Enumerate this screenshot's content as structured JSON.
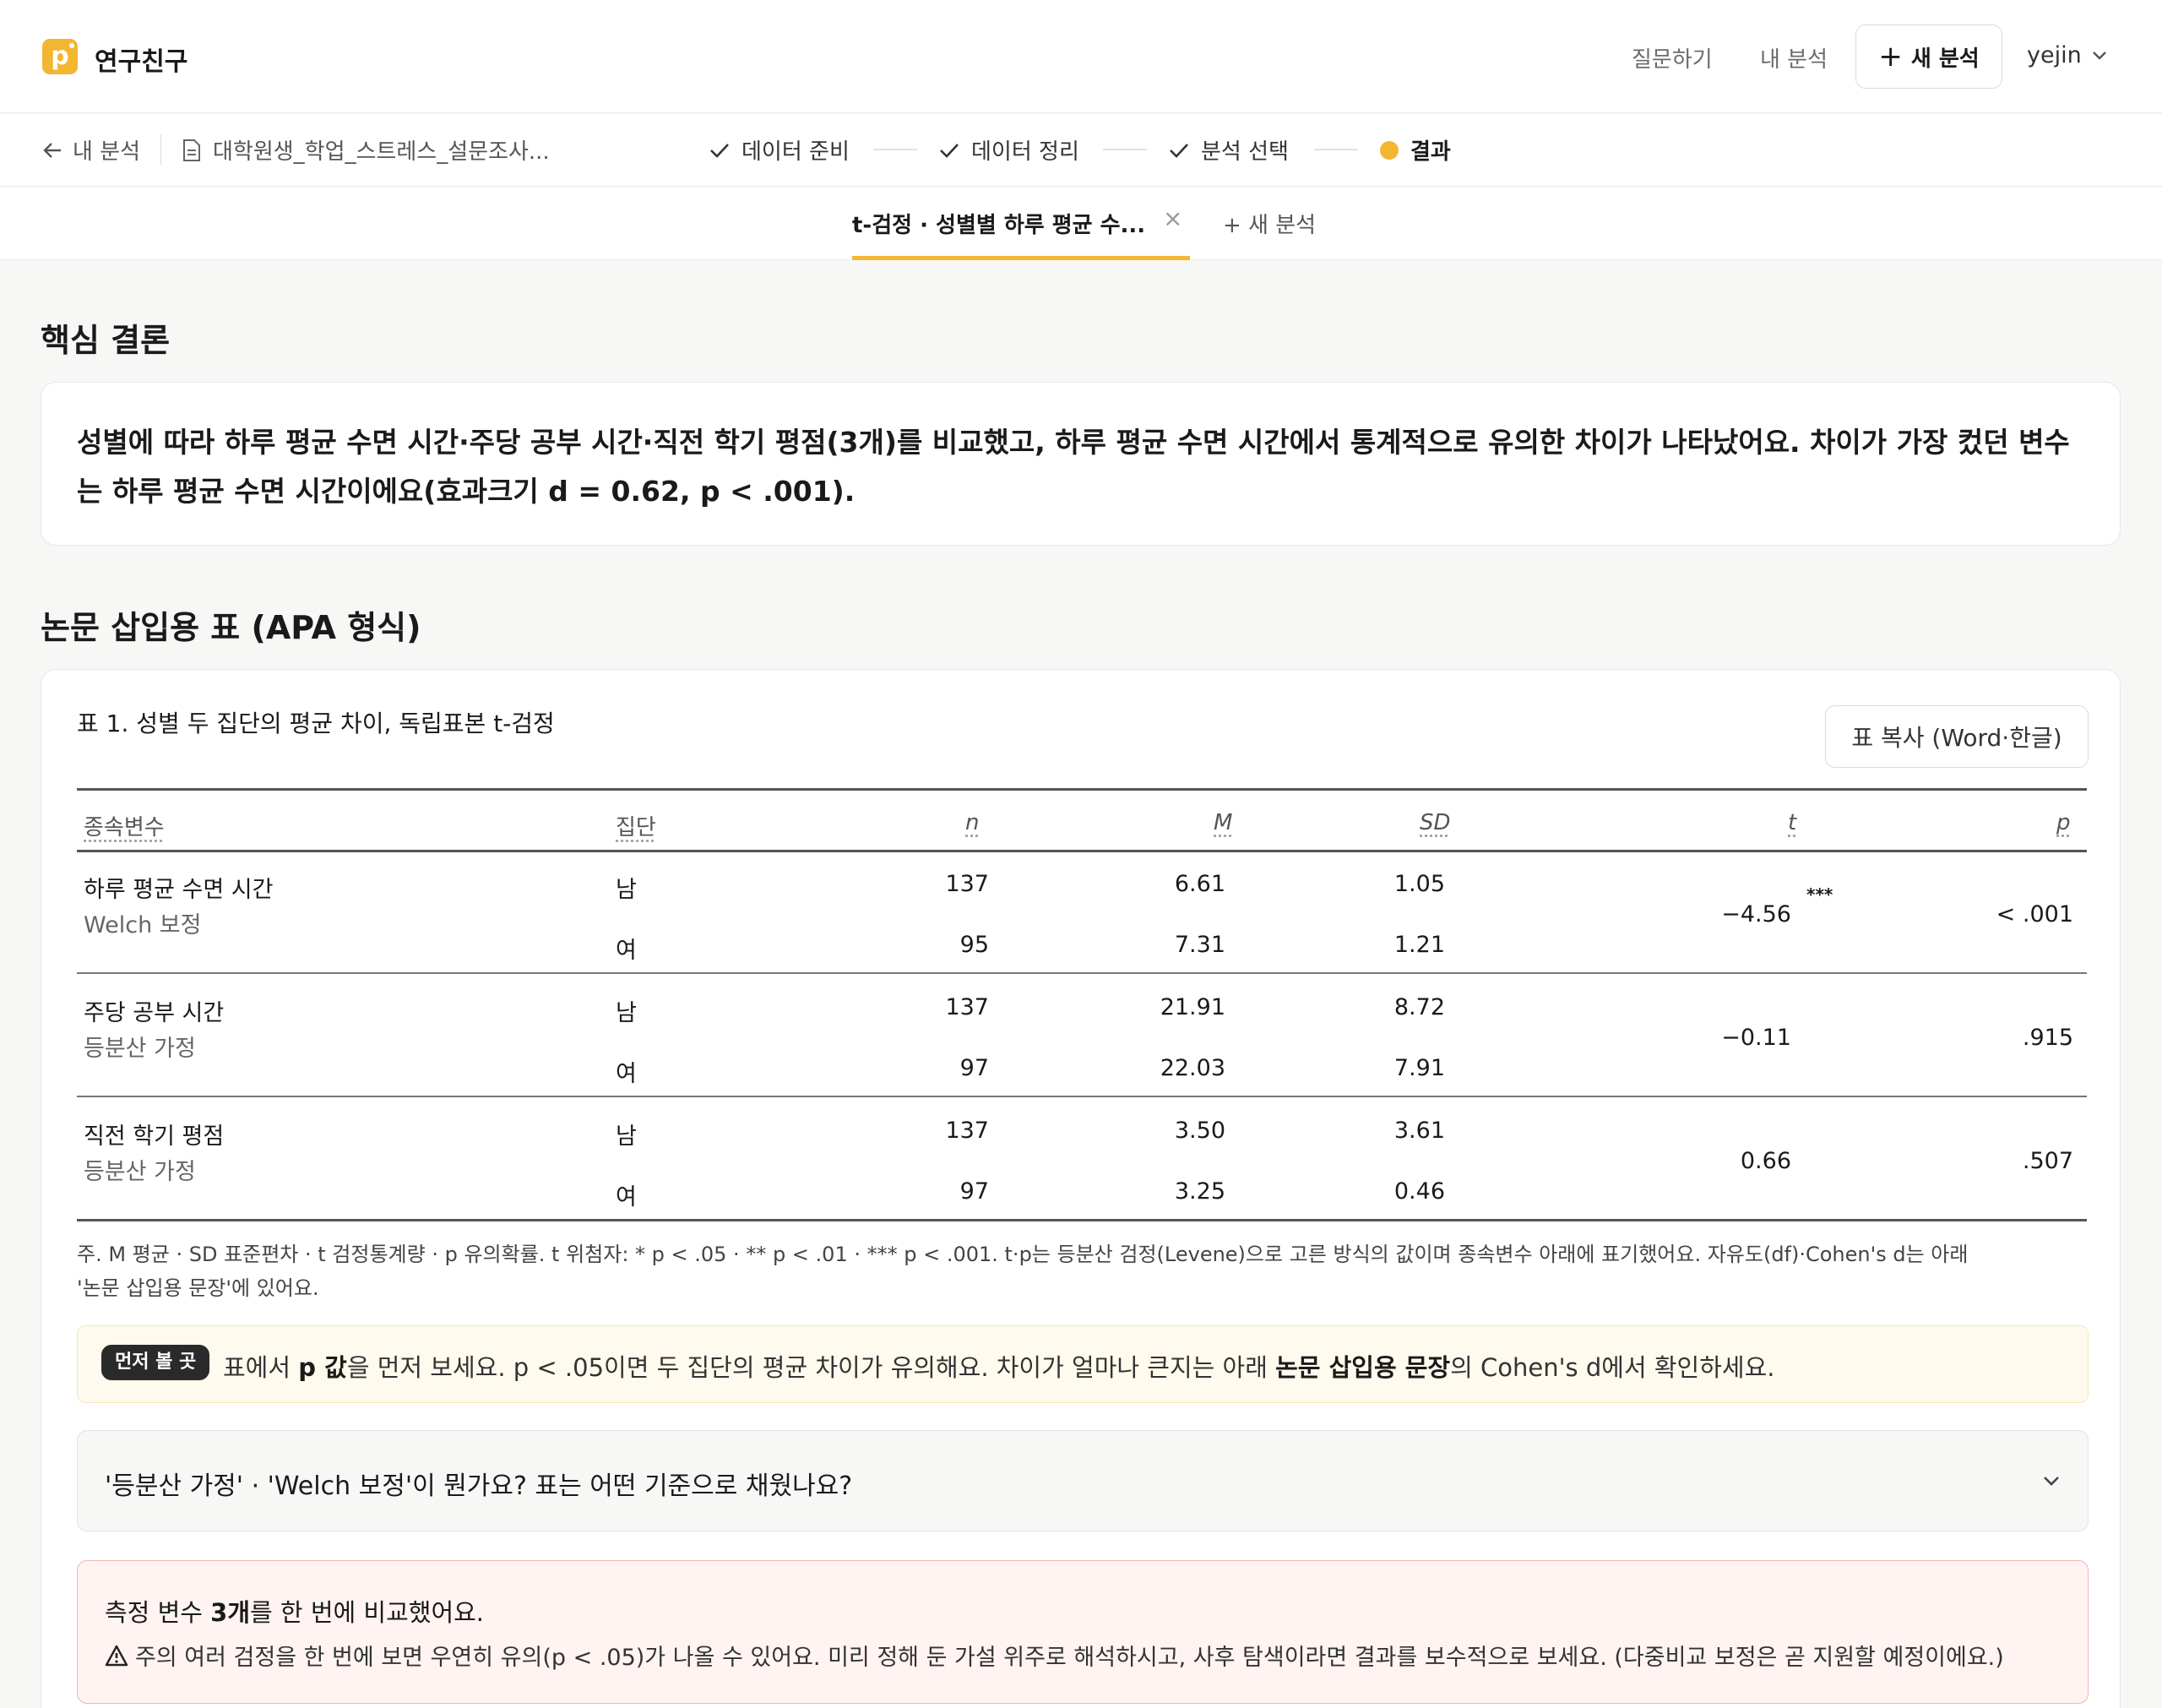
{
  "header": {
    "brand_logo": "p",
    "brand": "연구친구",
    "links": [
      "질문하기",
      "내 분석"
    ],
    "new_analysis": "새 분석",
    "user": "yejin"
  },
  "steps": {
    "back": "내 분석",
    "file": "대학원생_학업_스트레스_설문조사...",
    "items": [
      {
        "label": "데이터 준비",
        "state": "done"
      },
      {
        "label": "데이터 정리",
        "state": "done"
      },
      {
        "label": "분석 선택",
        "state": "done"
      },
      {
        "label": "결과",
        "state": "active"
      }
    ]
  },
  "tabs": {
    "active": "t-검정 · 성별별 하루 평균 수...",
    "new": "+ 새 분석"
  },
  "conclusion": {
    "title": "핵심 결론",
    "text": "성별에 따라 하루 평균 수면 시간·주당 공부 시간·직전 학기 평점(3개)를 비교했고, 하루 평균 수면 시간에서 통계적으로 유의한 차이가 나타났어요. 차이가 가장 컸던 변수는 하루 평균 수면 시간이에요(효과크기 d = 0.62, p < .001)."
  },
  "table_section": {
    "title": "논문 삽입용 표 (APA 형식)",
    "caption": "표 1. 성별 두 집단의 평균 차이, 독립표본 t-검정",
    "copy_button": "표 복사 (Word·한글)",
    "headers": {
      "dv": "종속변수",
      "group": "집단",
      "n": "n",
      "m": "M",
      "sd": "SD",
      "t": "t",
      "p": "p"
    },
    "rows": [
      {
        "dv": "하루 평균 수면 시간",
        "method": "Welch 보정",
        "g1": "남",
        "n1": "137",
        "m1": "6.61",
        "sd1": "1.05",
        "g2": "여",
        "n2": "95",
        "m2": "7.31",
        "sd2": "1.21",
        "t": "−4.56",
        "stars": "***",
        "p": "< .001"
      },
      {
        "dv": "주당 공부 시간",
        "method": "등분산 가정",
        "g1": "남",
        "n1": "137",
        "m1": "21.91",
        "sd1": "8.72",
        "g2": "여",
        "n2": "97",
        "m2": "22.03",
        "sd2": "7.91",
        "t": "−0.11",
        "stars": "",
        "p": ".915"
      },
      {
        "dv": "직전 학기 평점",
        "method": "등분산 가정",
        "g1": "남",
        "n1": "137",
        "m1": "3.50",
        "sd1": "3.61",
        "g2": "여",
        "n2": "97",
        "m2": "3.25",
        "sd2": "0.46",
        "t": "0.66",
        "stars": "",
        "p": ".507"
      }
    ],
    "note_line1": "주. M 평균 · SD 표준편차 · t 검정통계량 · p 유의확률. t 위첨자: * p < .05 · ** p < .01 · *** p < .001. t·p는 등분산 검정(Levene)으로 고른 방식의 값이며 종속변수 아래에 표기했어요. 자유도(df)·Cohen's d는 아래",
    "note_line2": "'논문 삽입용 문장'에 있어요.",
    "tip_badge": "먼저 볼 곳",
    "tip_1": "표에서 ",
    "tip_b1": "p 값",
    "tip_2": "을 먼저 보세요. p < .05이면 두 집단의 평균 차이가 유의해요. 차이가 얼마나 큰지는 아래 ",
    "tip_b2": "논문 삽입용 문장",
    "tip_3": "의 Cohen's d에서 확인하세요.",
    "accordion": "'등분산 가정' · 'Welch 보정'이 뭔가요? 표는 어떤 기준으로 채웠나요?",
    "warn_1": "측정 변수 ",
    "warn_b": "3개",
    "warn_2": "를 한 번에 비교했어요.",
    "warn_text": "주의 여러 검정을 한 번에 보면 우연히 유의(p < .05)가 나올 수 있어요. 미리 정해 둔 가설 위주로 해석하시고, 사후 탐색이라면 결과를 보수적으로 보세요. (다중비교 보정은 곧 지원할 예정이에요.)"
  },
  "colors": {
    "accent": "#f2b631",
    "warn_bg": "#fff4f2",
    "tip_bg": "#fffaee"
  }
}
